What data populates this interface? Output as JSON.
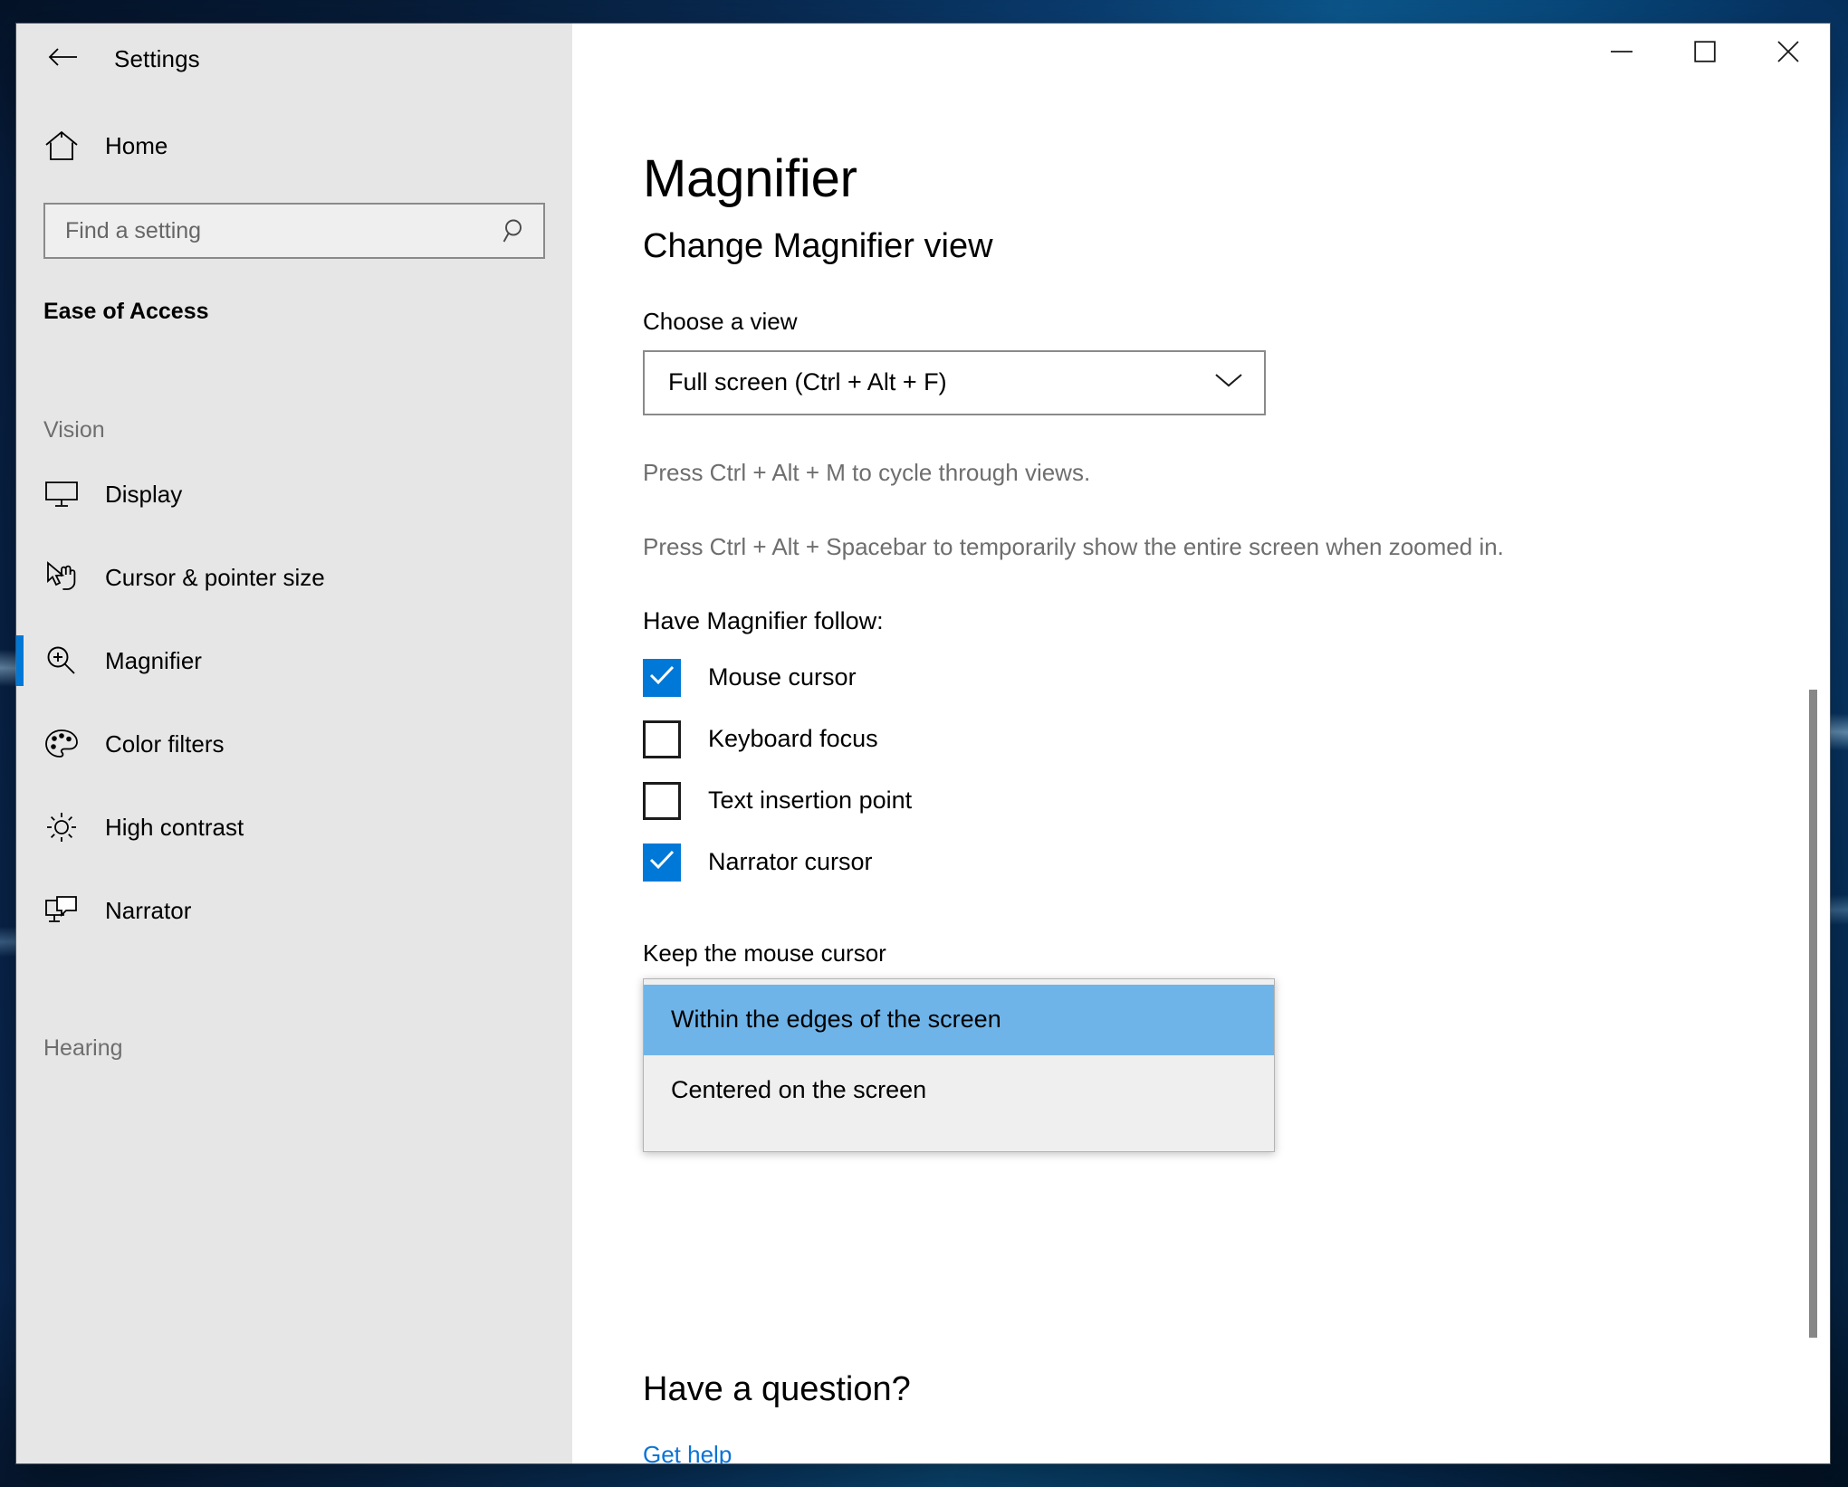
{
  "window": {
    "title": "Settings",
    "back_icon": "back-arrow-icon",
    "minimize_label": "Minimize",
    "maximize_label": "Maximize",
    "close_label": "Close"
  },
  "sidebar": {
    "home_label": "Home",
    "home_icon": "home-icon",
    "search": {
      "placeholder": "Find a setting",
      "value": "",
      "icon": "search-icon"
    },
    "category": "Ease of Access",
    "groups": [
      {
        "header": "Vision",
        "items": [
          {
            "label": "Display",
            "icon": "monitor-icon",
            "selected": false
          },
          {
            "label": "Cursor & pointer size",
            "icon": "pointer-icon",
            "selected": false
          },
          {
            "label": "Magnifier",
            "icon": "magnifier-icon",
            "selected": true
          },
          {
            "label": "Color filters",
            "icon": "palette-icon",
            "selected": false
          },
          {
            "label": "High contrast",
            "icon": "sun-icon",
            "selected": false
          },
          {
            "label": "Narrator",
            "icon": "narrator-icon",
            "selected": false
          }
        ]
      },
      {
        "header": "Hearing",
        "items": []
      }
    ]
  },
  "main": {
    "page_title": "Magnifier",
    "section_heading": "Change Magnifier view",
    "choose_view_label": "Choose a view",
    "view_select": {
      "value": "Full screen (Ctrl + Alt + F)",
      "chevron_icon": "chevron-down-icon"
    },
    "hint_1": "Press Ctrl + Alt + M to cycle through views.",
    "hint_2": "Press Ctrl + Alt + Spacebar to temporarily show the entire screen when zoomed in.",
    "follow_label": "Have Magnifier follow:",
    "checkboxes": [
      {
        "label": "Mouse cursor",
        "checked": true
      },
      {
        "label": "Keyboard focus",
        "checked": false
      },
      {
        "label": "Text insertion point",
        "checked": false
      },
      {
        "label": "Narrator cursor",
        "checked": true
      }
    ],
    "keep_cursor_label": "Keep the mouse cursor",
    "keep_cursor_options": [
      {
        "label": "Within the edges of the screen",
        "highlighted": true
      },
      {
        "label": "Centered on the screen",
        "highlighted": false
      }
    ],
    "have_question": "Have a question?",
    "get_help": "Get help"
  },
  "colors": {
    "accent": "#0078d7",
    "highlight": "#6fb4e8",
    "link": "#0a73d6",
    "sidebar_bg": "#e6e6e6"
  }
}
